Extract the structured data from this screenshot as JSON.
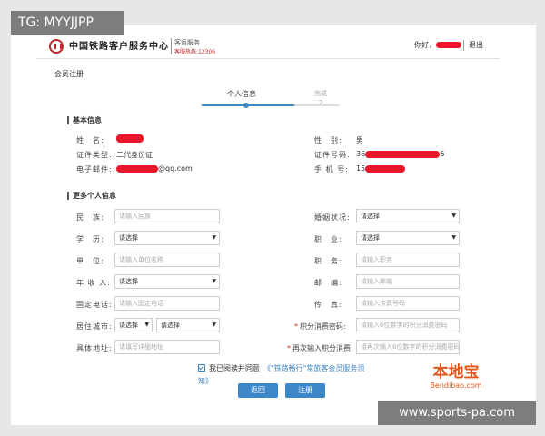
{
  "watermarks": {
    "top_left": "TG: MYYJJPP",
    "bottom_right": "www.sports-pa.com"
  },
  "header": {
    "brand": "中国铁路客户服务中心",
    "service": "客运服务",
    "hotline": "客服热线:12306",
    "greeting": "你好，",
    "logout": "退出"
  },
  "breadcrumb": "会员注册",
  "steps": [
    {
      "label": "个人信息"
    },
    {
      "label": "完成",
      "number": "2"
    }
  ],
  "basic": {
    "title": "基本信息",
    "name_label": "姓　名:",
    "gender_label": "性　别:",
    "gender_value": "男",
    "idtype_label": "证件类型:",
    "idtype_value": "二代身份证",
    "idnum_label": "证件号码:",
    "idnum_prefix": "36",
    "idnum_suffix": "6",
    "email_label": "电子邮件:",
    "email_suffix": "@qq.com",
    "phone_label": "手 机 号:",
    "phone_prefix": "15"
  },
  "more": {
    "title": "更多个人信息",
    "nation_label": "民　族:",
    "nation_placeholder": "请输入民族",
    "marital_label": "婚姻状况:",
    "marital_value": "请选择",
    "education_label": "学　历:",
    "education_value": "请选择",
    "job_label": "职　业:",
    "job_value": "请选择",
    "company_label": "单　位:",
    "company_placeholder": "请输入单位名称",
    "position_label": "职　务:",
    "position_placeholder": "请输入职务",
    "income_label": "年 收 入:",
    "income_value": "请选择",
    "postcode_label": "邮　编:",
    "postcode_placeholder": "请输入邮编",
    "tel_label": "固定电话:",
    "tel_placeholder": "请输入固定电话",
    "fax_label": "传　真:",
    "fax_placeholder": "请输入传真号码",
    "city_label": "居住城市:",
    "city_value1": "请选择",
    "city_value2": "请选择",
    "pwd_label": "积分消费密码:",
    "pwd_placeholder": "请输入6位数字的积分消费密码",
    "address_label": "具体地址:",
    "address_placeholder": "请填写详细地址",
    "pwd2_label": "再次输入积分消费",
    "pwd2_placeholder": "请再次输入6位数字的积分消费密码"
  },
  "agreement": {
    "prefix": "我已阅读并同意",
    "link": "《\"铁路畅行\"常旅客会员服务须",
    "tail": "知》"
  },
  "buttons": {
    "back": "返回",
    "register": "注册"
  },
  "site_logo": {
    "main": "本地宝",
    "sub": "Bendibao.com"
  },
  "colors": {
    "accent": "#3d87c9",
    "brand_red": "#c0262b",
    "redact": "#e8182a",
    "logo_orange": "#e4551c"
  }
}
